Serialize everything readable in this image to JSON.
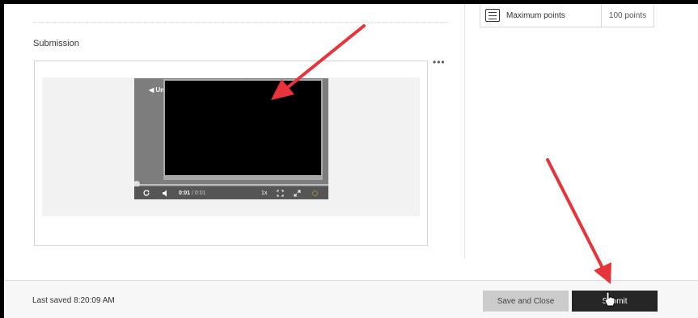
{
  "rubric": {
    "label": "Maximum points",
    "value": "100 points",
    "icon": "checklist-icon"
  },
  "submission": {
    "title": "Submission",
    "more_label": "•••"
  },
  "player": {
    "unmute_label": "◀ Un",
    "current_time": "0:01",
    "duration": "/ 0:01",
    "speed": "1x",
    "progress": 0,
    "icons": [
      "replay-icon",
      "volume-icon",
      "speed-label",
      "expand-icon",
      "fullscreen-icon",
      "settings-icon"
    ]
  },
  "footer": {
    "last_saved": "Last saved 8:20:09 AM",
    "save_close_label": "Save and Close",
    "submit_label": "Submit"
  },
  "colors": {
    "annotation_arrow": "#e8333a",
    "submit_bg": "#262626",
    "save_close_bg": "#cccccc"
  }
}
